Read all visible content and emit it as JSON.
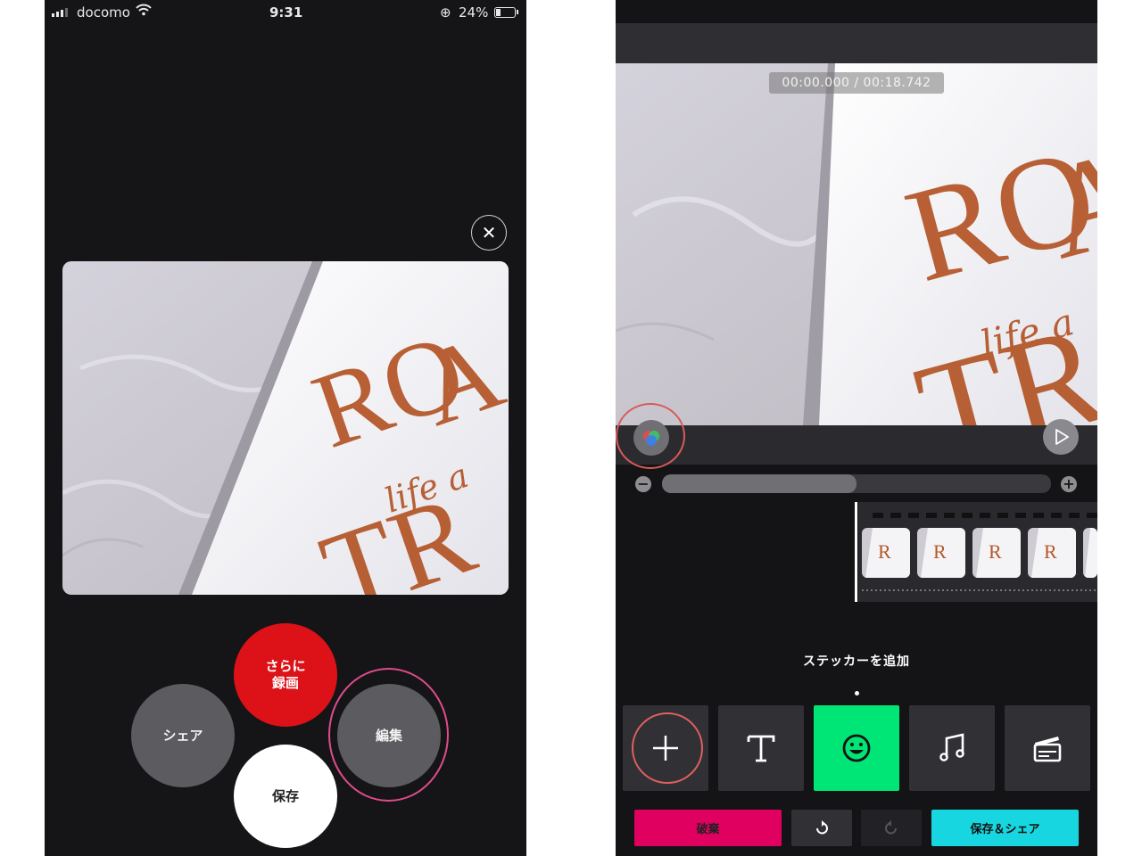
{
  "left_screen": {
    "status_bar": {
      "carrier": "docomo",
      "time": "9:31",
      "battery": "24%"
    },
    "bubbles": {
      "share": "シェア",
      "record_more_line1": "さらに",
      "record_more_line2": "録画",
      "save": "保存",
      "edit": "編集"
    },
    "icons": [
      "close-icon",
      "wifi-icon",
      "signal-icon",
      "battery-icon",
      "rotation-lock-icon"
    ]
  },
  "right_screen": {
    "timecode": "00:00.000 / 00:18.742",
    "zoom_level": 0.5,
    "sticker_label": "ステッカーを追加",
    "tools": [
      {
        "name": "add",
        "icon": "plus-icon"
      },
      {
        "name": "text",
        "icon": "text-icon"
      },
      {
        "name": "sticker",
        "icon": "smiley-icon",
        "active": true
      },
      {
        "name": "music",
        "icon": "music-note-icon"
      },
      {
        "name": "clip",
        "icon": "clapperboard-icon"
      }
    ],
    "buttons": {
      "discard": "破棄",
      "save_share": "保存＆シェア"
    },
    "colors": {
      "active_tool": "#00e676",
      "discard": "#e0005f",
      "save_share": "#17d6e0",
      "record": "#dd1118",
      "highlight_ring": "#e04b8c"
    }
  }
}
